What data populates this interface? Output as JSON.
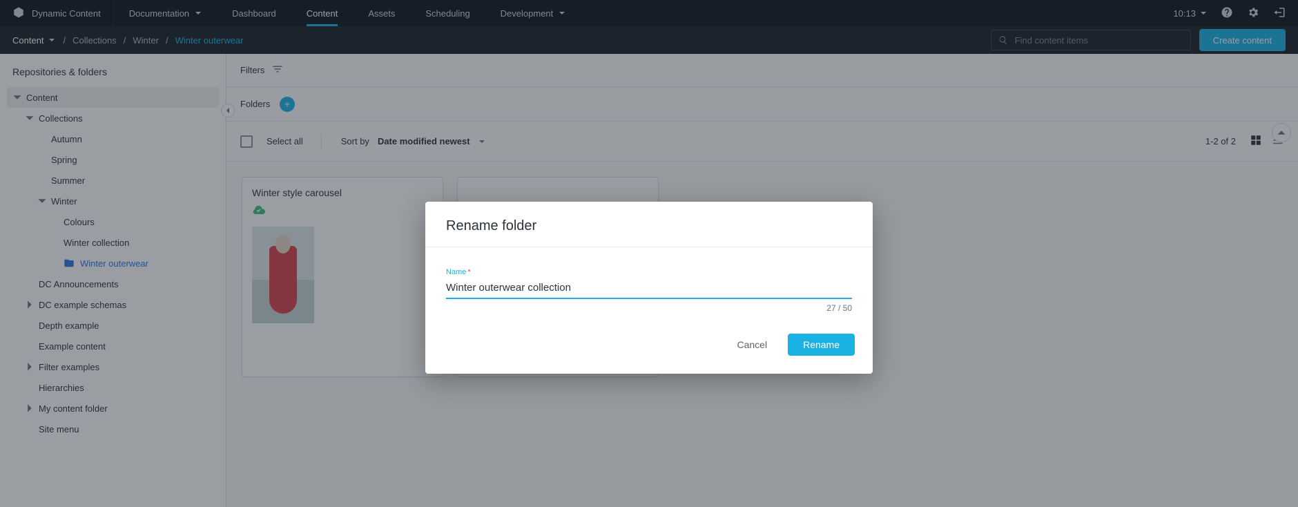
{
  "brand": "Dynamic Content",
  "topnav": {
    "items": [
      {
        "label": "Documentation",
        "caret": true
      },
      {
        "label": "Dashboard"
      },
      {
        "label": "Content",
        "active": true
      },
      {
        "label": "Assets"
      },
      {
        "label": "Scheduling"
      },
      {
        "label": "Development",
        "caret": true
      }
    ],
    "time": "10:13"
  },
  "subnav": {
    "dropdown": "Content",
    "crumbs": [
      "Collections",
      "Winter",
      "Winter outerwear"
    ],
    "search_placeholder": "Find content items",
    "create_label": "Create content"
  },
  "sidebar": {
    "header": "Repositories & folders",
    "tree": [
      {
        "label": "Content",
        "depth": 0,
        "tw": "down",
        "sel": true
      },
      {
        "label": "Collections",
        "depth": 1,
        "tw": "down"
      },
      {
        "label": "Autumn",
        "depth": 2,
        "tw": "none"
      },
      {
        "label": "Spring",
        "depth": 2,
        "tw": "none"
      },
      {
        "label": "Summer",
        "depth": 2,
        "tw": "none"
      },
      {
        "label": "Winter",
        "depth": 2,
        "tw": "down"
      },
      {
        "label": "Colours",
        "depth": 3,
        "tw": "none"
      },
      {
        "label": "Winter collection",
        "depth": 3,
        "tw": "none"
      },
      {
        "label": "Winter outerwear",
        "depth": 3,
        "tw": "none",
        "active": true,
        "folder": true
      },
      {
        "label": "DC Announcements",
        "depth": 1,
        "tw": "none"
      },
      {
        "label": "DC example schemas",
        "depth": 1,
        "tw": "right"
      },
      {
        "label": "Depth example",
        "depth": 1,
        "tw": "none"
      },
      {
        "label": "Example content",
        "depth": 1,
        "tw": "none"
      },
      {
        "label": "Filter examples",
        "depth": 1,
        "tw": "right"
      },
      {
        "label": "Hierarchies",
        "depth": 1,
        "tw": "none"
      },
      {
        "label": "My content folder",
        "depth": 1,
        "tw": "right"
      },
      {
        "label": "Site menu",
        "depth": 1,
        "tw": "none"
      }
    ]
  },
  "content": {
    "filters_label": "Filters",
    "folders_label": "Folders",
    "select_all_label": "Select all",
    "sort_by_label": "Sort by",
    "sort_value": "Date modified newest",
    "range_label": "1-2 of 2",
    "cards": [
      {
        "title": "Winter style carousel",
        "synced": true,
        "thumb": true
      },
      {
        "title": "",
        "synced": false,
        "thumb": false
      }
    ]
  },
  "modal": {
    "title": "Rename folder",
    "field_label": "Name",
    "required_mark": "*",
    "value": "Winter outerwear collection",
    "counter": "27 / 50",
    "cancel": "Cancel",
    "confirm": "Rename"
  }
}
